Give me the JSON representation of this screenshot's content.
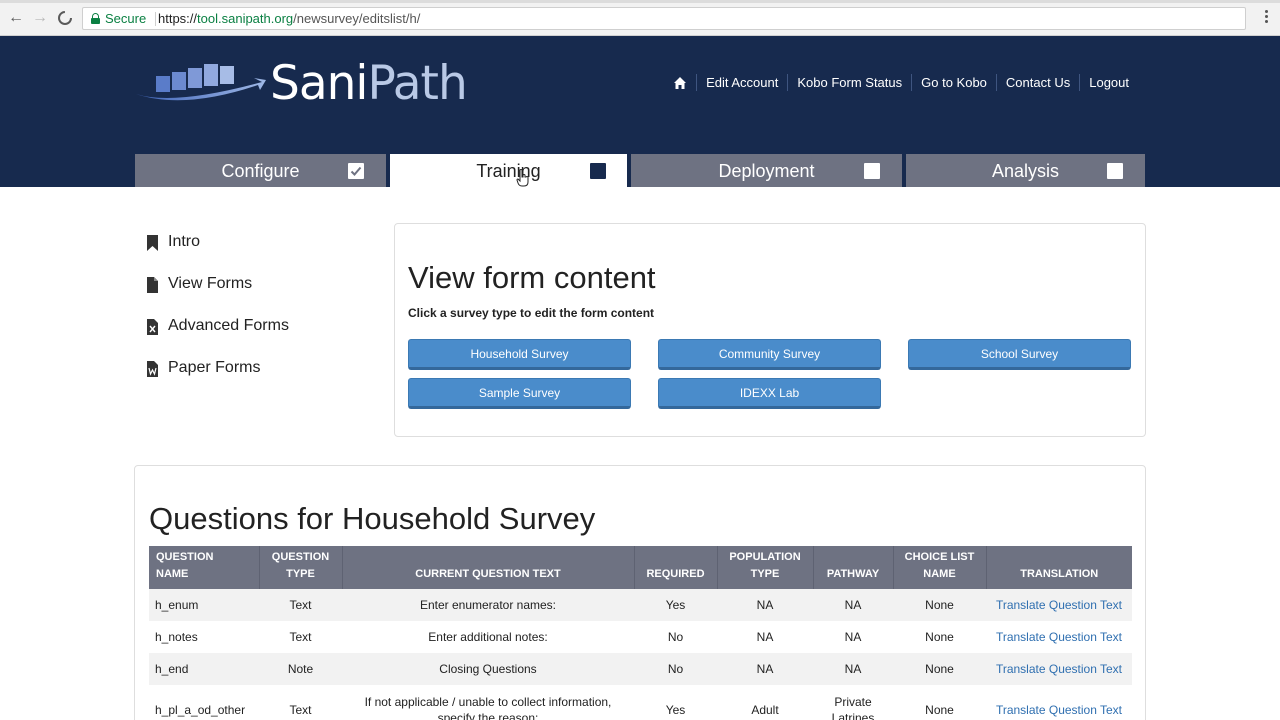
{
  "browser": {
    "secure_label": "Secure",
    "url_scheme": "https://",
    "url_host": "tool.sanipath.org",
    "url_path": "/newsurvey/editslist/h/"
  },
  "header": {
    "logo_text_a": "Sani",
    "logo_text_b": "Path",
    "nav": [
      "Edit Account",
      "Kobo Form Status",
      "Go to Kobo",
      "Contact Us",
      "Logout"
    ]
  },
  "tabs": [
    {
      "label": "Configure",
      "state": "checked"
    },
    {
      "label": "Training",
      "state": "current"
    },
    {
      "label": "Deployment",
      "state": "empty"
    },
    {
      "label": "Analysis",
      "state": "empty"
    }
  ],
  "sidebar": {
    "items": [
      {
        "label": "Intro",
        "icon": "bookmark-icon"
      },
      {
        "label": "View Forms",
        "icon": "file-icon"
      },
      {
        "label": "Advanced Forms",
        "icon": "excel-file-icon"
      },
      {
        "label": "Paper Forms",
        "icon": "word-file-icon"
      }
    ]
  },
  "form_content": {
    "title": "View form content",
    "subtitle": "Click a survey type to edit the form content",
    "buttons": [
      "Household Survey",
      "Community Survey",
      "School Survey",
      "Sample Survey",
      "IDEXX Lab"
    ]
  },
  "questions": {
    "title": "Questions for Household Survey",
    "headers": [
      [
        "QUESTION",
        "NAME"
      ],
      [
        "QUESTION",
        "TYPE"
      ],
      [
        "",
        "CURRENT QUESTION TEXT"
      ],
      [
        "",
        "REQUIRED"
      ],
      [
        "POPULATION",
        "TYPE"
      ],
      [
        "",
        "PATHWAY"
      ],
      [
        "CHOICE LIST",
        "NAME"
      ],
      [
        "",
        "TRANSLATION"
      ]
    ],
    "rows": [
      [
        "h_enum",
        "Text",
        "Enter enumerator names:",
        "Yes",
        "NA",
        "NA",
        "None",
        "Translate Question Text"
      ],
      [
        "h_notes",
        "Text",
        "Enter additional notes:",
        "No",
        "NA",
        "NA",
        "None",
        "Translate Question Text"
      ],
      [
        "h_end",
        "Note",
        "Closing Questions",
        "No",
        "NA",
        "NA",
        "None",
        "Translate Question Text"
      ],
      [
        "h_pl_a_od_other",
        "Text",
        "If not applicable / unable to collect information, specify the reason:",
        "Yes",
        "Adult",
        "Private Latrines",
        "None",
        "Translate Question Text"
      ]
    ]
  },
  "colors": {
    "header_bg": "#172a4e",
    "tab_bg": "#6e7282",
    "button_bg": "#4a8ccb",
    "link": "#2f6fb0",
    "secure_green": "#0b8043"
  }
}
